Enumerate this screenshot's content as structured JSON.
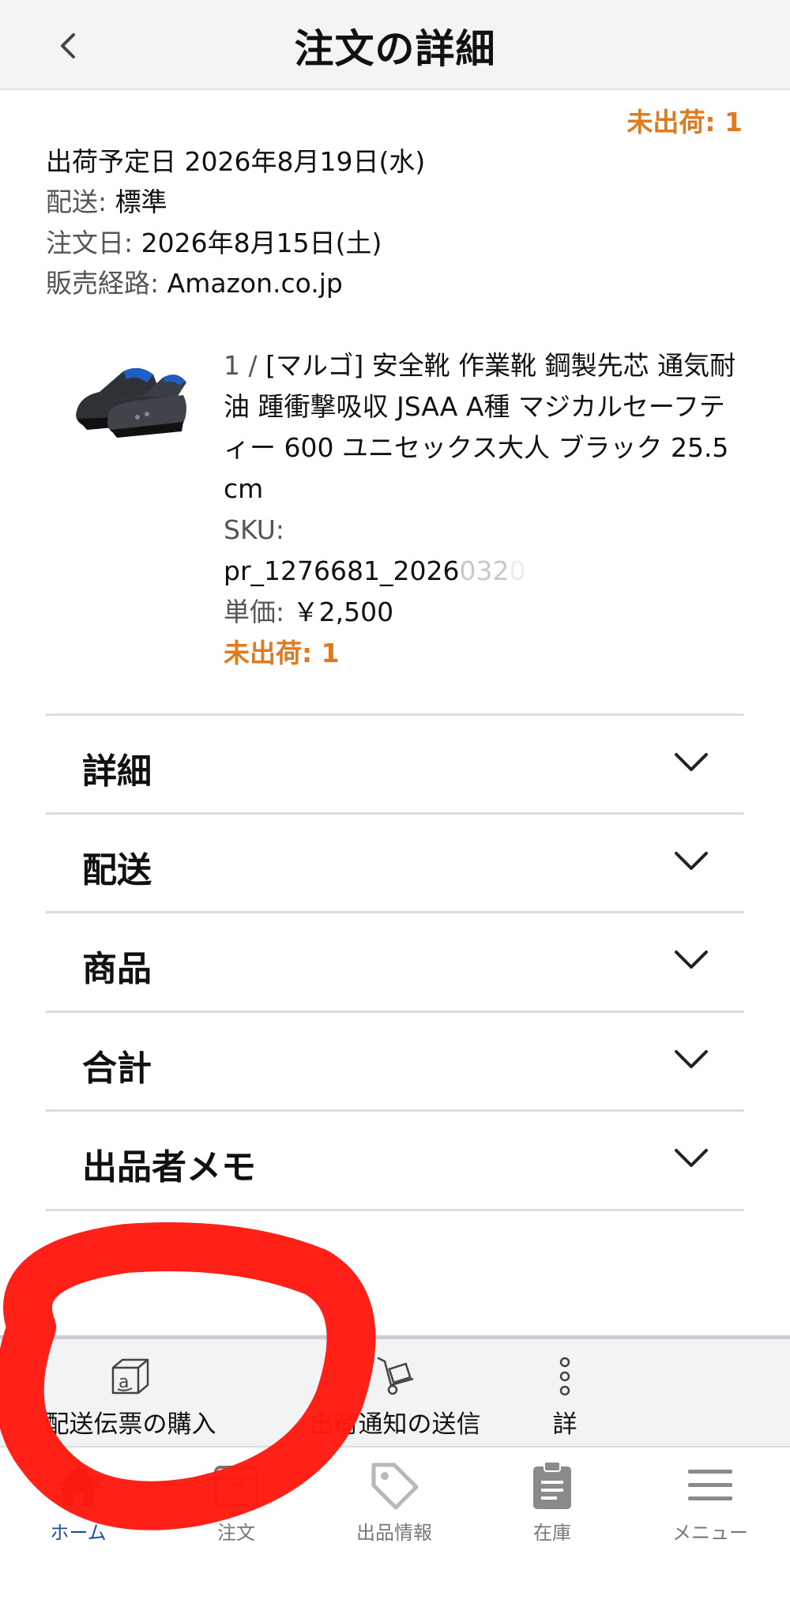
{
  "header": {
    "title": "注文の詳細",
    "back_icon": "chevron-left-icon"
  },
  "order": {
    "unshipped_top": "未出荷: 1",
    "ship_date": "出荷予定日 2026年8月19日(水)",
    "delivery_label": "配送:",
    "delivery_value": "標準",
    "order_date_label": "注文日:",
    "order_date_value": "2026年8月15日(土)",
    "channel_label": "販売経路:",
    "channel_value": "Amazon.co.jp"
  },
  "product": {
    "image_icon": "safety-shoe-image",
    "qty_prefix": "1 /",
    "title": "[マルゴ] 安全靴 作業靴 鋼製先芯 通気耐油 踵衝撃吸収 JSAA A種 マジカルセーフティー 600 ユニセックス大人 ブラック 25.5 cm",
    "sku_label": "SKU:",
    "sku_value": "pr_1276681_2026",
    "sku_faded": "032",
    "sku_faded_2": "0",
    "price_label": "単価:",
    "price_value": "￥2,500",
    "unshipped": "未出荷: 1"
  },
  "sections": [
    {
      "label": "詳細"
    },
    {
      "label": "配送"
    },
    {
      "label": "商品"
    },
    {
      "label": "合計"
    },
    {
      "label": "出品者メモ"
    }
  ],
  "actions": [
    {
      "label": "配送伝票の購入",
      "icon": "amazon-box-icon"
    },
    {
      "label": "出荷通知の送信",
      "icon": "hand-truck-icon"
    },
    {
      "label": "詳",
      "icon": "more-vertical-icon"
    }
  ],
  "tabs": [
    {
      "label": "ホーム",
      "icon": "home-icon",
      "active": true
    },
    {
      "label": "注文",
      "icon": "box-icon",
      "active": false
    },
    {
      "label": "出品情報",
      "icon": "tag-icon",
      "active": false
    },
    {
      "label": "在庫",
      "icon": "clipboard-icon",
      "active": false
    },
    {
      "label": "メニュー",
      "icon": "hamburger-menu-icon",
      "active": false
    }
  ],
  "colors": {
    "accent_orange": "#e07a1f",
    "active_tab": "#1f4e9c",
    "annotation_red": "#ff1a0f"
  }
}
